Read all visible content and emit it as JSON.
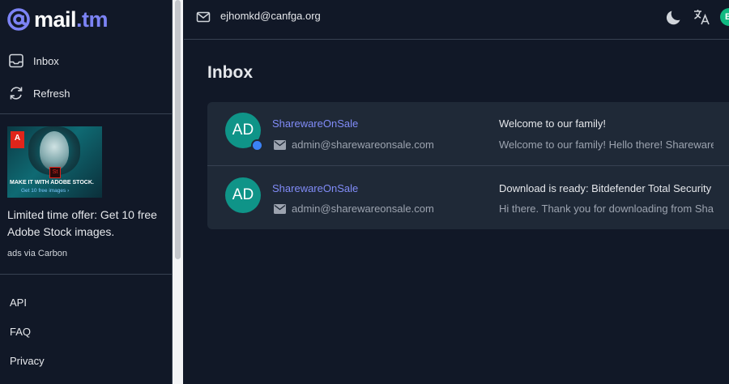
{
  "logo": {
    "prefix": "mail",
    "suffix": ".tm"
  },
  "sidebar": {
    "nav": [
      {
        "label": "Inbox",
        "icon": "inbox-icon"
      },
      {
        "label": "Refresh",
        "icon": "refresh-icon"
      }
    ],
    "ad": {
      "image_headline": "MAKE IT WITH ADOBE STOCK.",
      "image_cta": "Get 10 free images ›",
      "image_brand": "Adobe",
      "image_badge": "St",
      "text": "Limited time offer: Get 10 free Adobe Stock images.",
      "via": "ads via Carbon"
    },
    "footer_links": [
      "API",
      "FAQ",
      "Privacy"
    ]
  },
  "header": {
    "email": "ejhomkd@canfga.org",
    "avatar_initial": "E"
  },
  "main": {
    "title": "Inbox",
    "messages": [
      {
        "initials": "AD",
        "unread": true,
        "sender": "SharewareOnSale",
        "address": "admin@sharewareonsale.com",
        "subject": "Welcome to our family!",
        "preview": "Welcome to our family! Hello there! SharewareOnSale"
      },
      {
        "initials": "AD",
        "unread": false,
        "sender": "SharewareOnSale",
        "address": "admin@sharewareonsale.com",
        "subject": "Download is ready: Bitdefender Total Security",
        "preview": "Hi there. Thank you for downloading from SharewareOnSale"
      }
    ]
  },
  "colors": {
    "background": "#111827",
    "panel": "#1f2937",
    "accent": "#7c83f5",
    "sender_link": "#818cf8",
    "avatar": "#0f9488",
    "unread_dot": "#3b82f6"
  }
}
